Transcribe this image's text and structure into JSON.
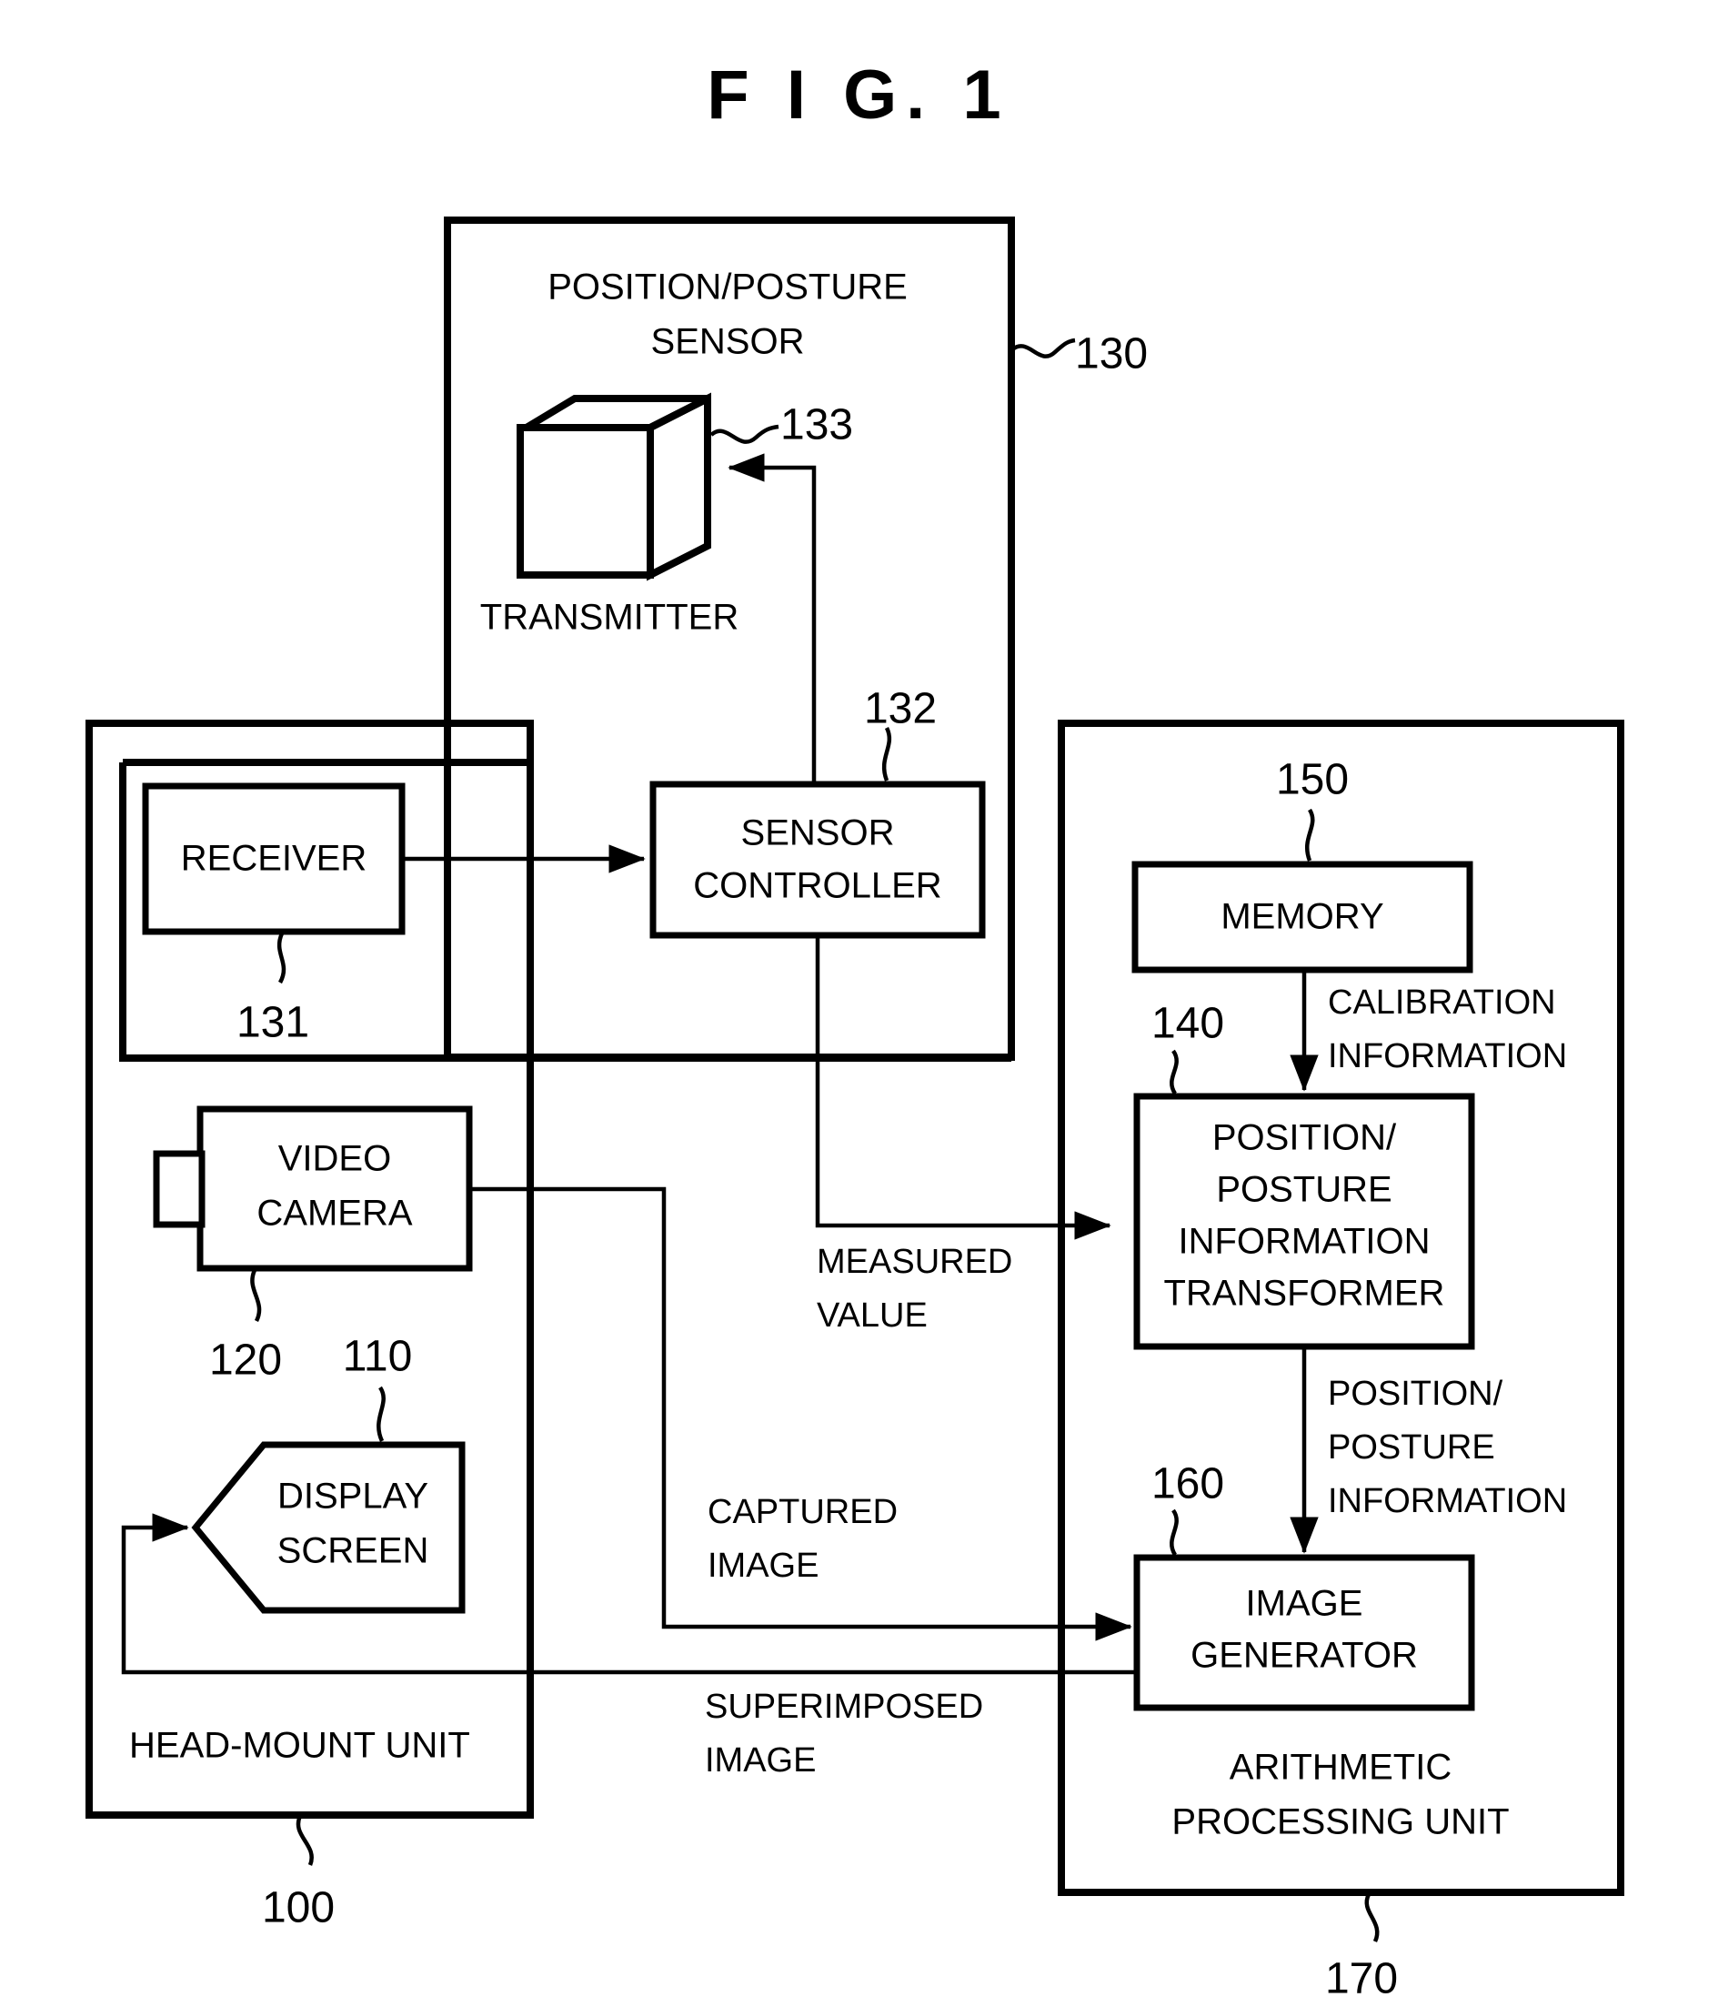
{
  "figure": {
    "title": "F I G.  1"
  },
  "outer_blocks": {
    "sensor_unit": {
      "title_line1": "POSITION/POSTURE",
      "title_line2": "SENSOR",
      "ref": "130"
    },
    "head_mount_unit": {
      "title": "HEAD-MOUNT UNIT",
      "ref": "100"
    },
    "arithmetic_unit": {
      "title_line1": "ARITHMETIC",
      "title_line2": "PROCESSING UNIT",
      "ref": "170"
    }
  },
  "components": {
    "transmitter": {
      "label": "TRANSMITTER",
      "ref": "133",
      "shape": "cube-icon"
    },
    "receiver": {
      "label": "RECEIVER",
      "ref": "131"
    },
    "sensor_controller": {
      "label_line1": "SENSOR",
      "label_line2": "CONTROLLER",
      "ref": "132"
    },
    "memory": {
      "label": "MEMORY",
      "ref": "150"
    },
    "transformer": {
      "label_line1": "POSITION/",
      "label_line2": "POSTURE",
      "label_line3": "INFORMATION",
      "label_line4": "TRANSFORMER",
      "ref": "140"
    },
    "image_generator": {
      "label_line1": "IMAGE",
      "label_line2": "GENERATOR",
      "ref": "160"
    },
    "video_camera": {
      "label_line1": "VIDEO",
      "label_line2": "CAMERA",
      "ref": "120"
    },
    "display_screen": {
      "label_line1": "DISPLAY",
      "label_line2": "SCREEN",
      "ref": "110"
    }
  },
  "flow_labels": {
    "calibration_information": {
      "line1": "CALIBRATION",
      "line2": "INFORMATION"
    },
    "position_posture_information": {
      "line1": "POSITION/",
      "line2": "POSTURE",
      "line3": "INFORMATION"
    },
    "measured_value": {
      "line1": "MEASURED",
      "line2": "VALUE"
    },
    "captured_image": {
      "line1": "CAPTURED",
      "line2": "IMAGE"
    },
    "superimposed_image": {
      "line1": "SUPERIMPOSED",
      "line2": "IMAGE"
    }
  },
  "colors": {
    "stroke": "#000000",
    "background": "#ffffff"
  }
}
